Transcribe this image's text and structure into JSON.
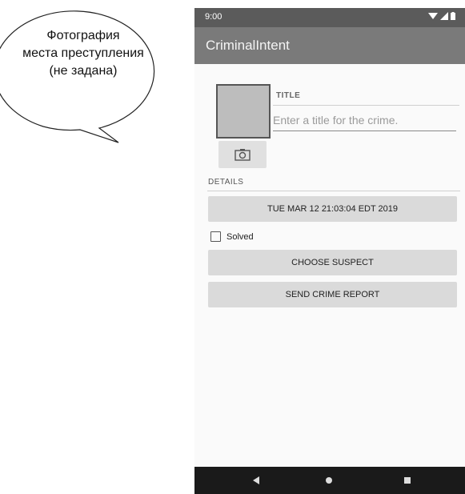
{
  "callout": {
    "line1": "Фотография",
    "line2": "места преступления",
    "line3": "(не задана)"
  },
  "status_bar": {
    "time": "9:00",
    "icons": [
      "wifi-icon",
      "signal-icon",
      "battery-icon"
    ]
  },
  "app_bar": {
    "title": "CriminalIntent"
  },
  "crime_form": {
    "title_label": "TITLE",
    "title_placeholder": "Enter a title for the crime.",
    "camera_icon": "camera-icon",
    "details_label": "DETAILS",
    "date_button": "TUE MAR 12 21:03:04 EDT 2019",
    "solved_label": "Solved",
    "solved_checked": false,
    "choose_suspect_button": "CHOOSE SUSPECT",
    "send_report_button": "SEND CRIME REPORT"
  },
  "nav_bar": {
    "icons": [
      "back-icon",
      "home-icon",
      "recents-icon"
    ]
  },
  "colors": {
    "status_bar": "#5b5b5b",
    "app_bar": "#7a7a7a",
    "button": "#dadada",
    "nav_bar": "#1a1a1a"
  }
}
